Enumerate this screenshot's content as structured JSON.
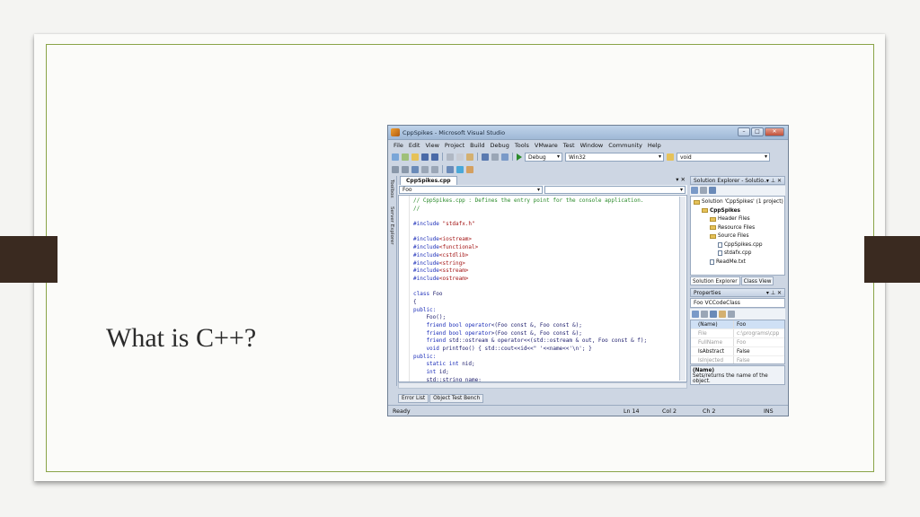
{
  "slide": {
    "title": "What is C++?",
    "accent_color": "#8aa448",
    "tab_color": "#3a2a20"
  },
  "window": {
    "title": "CppSpikes - Microsoft Visual Studio",
    "buttons": [
      "–",
      "□",
      "✕"
    ]
  },
  "menu": [
    "File",
    "Edit",
    "View",
    "Project",
    "Build",
    "Debug",
    "Tools",
    "VMware",
    "Test",
    "Window",
    "Community",
    "Help"
  ],
  "toolbar": {
    "config": "Debug",
    "platform": "Win32",
    "find_combo": "void"
  },
  "side_tabs": [
    "Toolbox",
    "Server Explorer"
  ],
  "editor": {
    "tab_label": "CppSpikes.cpp",
    "close": "▾ ✕",
    "nav_left": "Foo",
    "nav_right": "",
    "code_lines": [
      [
        {
          "t": "// CppSpikes.cpp : Defines the entry point for the console application.",
          "c": "green"
        }
      ],
      [
        {
          "t": "//",
          "c": "green"
        }
      ],
      [
        {
          "t": "",
          "c": "dark"
        }
      ],
      [
        {
          "t": "#include ",
          "c": "blue"
        },
        {
          "t": "\"stdafx.h\"",
          "c": "red"
        }
      ],
      [
        {
          "t": "",
          "c": "dark"
        }
      ],
      [
        {
          "t": "#include",
          "c": "blue"
        },
        {
          "t": "<iostream>",
          "c": "red"
        }
      ],
      [
        {
          "t": "#include",
          "c": "blue"
        },
        {
          "t": "<functional>",
          "c": "red"
        }
      ],
      [
        {
          "t": "#include",
          "c": "blue"
        },
        {
          "t": "<cstdlib>",
          "c": "red"
        }
      ],
      [
        {
          "t": "#include",
          "c": "blue"
        },
        {
          "t": "<string>",
          "c": "red"
        }
      ],
      [
        {
          "t": "#include",
          "c": "blue"
        },
        {
          "t": "<sstream>",
          "c": "red"
        }
      ],
      [
        {
          "t": "#include",
          "c": "blue"
        },
        {
          "t": "<ostream>",
          "c": "red"
        }
      ],
      [
        {
          "t": "",
          "c": "dark"
        }
      ],
      [
        {
          "t": "class ",
          "c": "blue"
        },
        {
          "t": "Foo",
          "c": "dark"
        }
      ],
      [
        {
          "t": "{",
          "c": "dark"
        }
      ],
      [
        {
          "t": "public:",
          "c": "blue"
        }
      ],
      [
        {
          "t": "    Foo();",
          "c": "dark"
        }
      ],
      [
        {
          "t": "    friend bool operator",
          "c": "blue"
        },
        {
          "t": "<(Foo const &, Foo const &);",
          "c": "dark"
        }
      ],
      [
        {
          "t": "    friend bool operator",
          "c": "blue"
        },
        {
          "t": ">(Foo const &, Foo const &);",
          "c": "dark"
        }
      ],
      [
        {
          "t": "    friend ",
          "c": "blue"
        },
        {
          "t": "std::ostream & operator<<(std::ostream & out, Foo const & f);",
          "c": "dark"
        }
      ],
      [
        {
          "t": "    void ",
          "c": "blue"
        },
        {
          "t": "printfoo() { std::cout<<id<<\" '<<name<<'\\n'; }",
          "c": "dark"
        }
      ],
      [
        {
          "t": "public:",
          "c": "blue"
        }
      ],
      [
        {
          "t": "    static int ",
          "c": "blue"
        },
        {
          "t": "nid;",
          "c": "dark"
        }
      ],
      [
        {
          "t": "    int ",
          "c": "blue"
        },
        {
          "t": "id;",
          "c": "dark"
        }
      ],
      [
        {
          "t": "    std::string name;",
          "c": "dark"
        }
      ]
    ]
  },
  "bottom_tabs": [
    "Error List",
    "Object Test Bench"
  ],
  "solution_explorer": {
    "title": "Solution Explorer - Solutio...",
    "controls": "▾ ⊥ ✕",
    "items": [
      {
        "label": "Solution 'CppSpikes' (1 project)",
        "indent": 0,
        "kind": "solution"
      },
      {
        "label": "CppSpikes",
        "indent": 1,
        "kind": "project"
      },
      {
        "label": "Header Files",
        "indent": 2,
        "kind": "folder"
      },
      {
        "label": "Resource Files",
        "indent": 2,
        "kind": "folder"
      },
      {
        "label": "Source Files",
        "indent": 2,
        "kind": "folder"
      },
      {
        "label": "CppSpikes.cpp",
        "indent": 3,
        "kind": "file"
      },
      {
        "label": "stdafx.cpp",
        "indent": 3,
        "kind": "file"
      },
      {
        "label": "ReadMe.txt",
        "indent": 2,
        "kind": "file"
      }
    ],
    "tabs": [
      "Solution Explorer",
      "Class View"
    ]
  },
  "properties": {
    "title": "Properties",
    "controls": "▾ ⊥ ✕",
    "object": "Foo VCCodeClass",
    "rows": [
      {
        "name": "(Name)",
        "value": "Foo",
        "selected": true,
        "dim": false
      },
      {
        "name": "File",
        "value": "c:\\programs\\cpp",
        "selected": false,
        "dim": true
      },
      {
        "name": "FullName",
        "value": "Foo",
        "selected": false,
        "dim": true
      },
      {
        "name": "IsAbstract",
        "value": "False",
        "selected": false,
        "dim": false
      },
      {
        "name": "IsInjected",
        "value": "False",
        "selected": false,
        "dim": true
      }
    ],
    "desc_title": "(Name)",
    "desc_text": "Sets/returns the name of the object."
  },
  "status": {
    "left": "Ready",
    "line": "Ln 14",
    "col": "Col 2",
    "ch": "Ch 2",
    "mode": "INS"
  }
}
